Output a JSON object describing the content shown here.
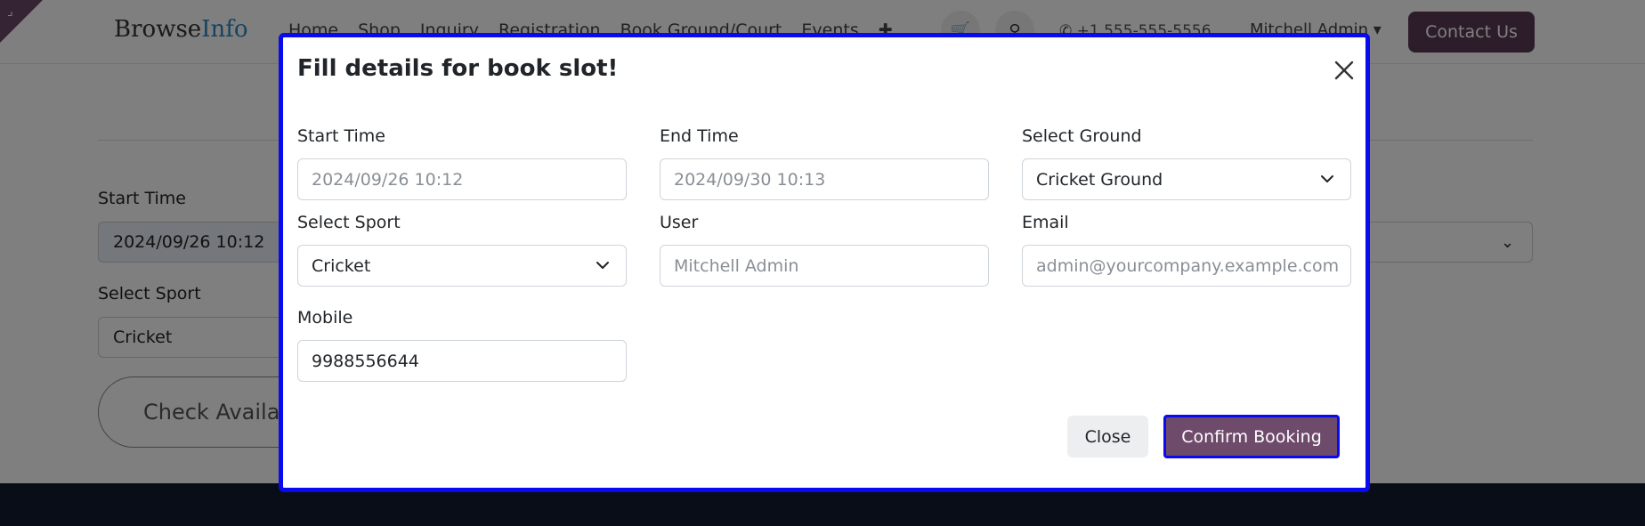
{
  "header": {
    "brand_part1": "Browse",
    "brand_part2": "Info",
    "nav": [
      "Home",
      "Shop",
      "Inquiry",
      "Registration",
      "Book Ground/Court",
      "Events"
    ],
    "phone": "+1 555-555-5556",
    "user": "Mitchell Admin",
    "contact_label": "Contact Us"
  },
  "background_form": {
    "start_time_label": "Start Time",
    "start_time_value": "2024/09/26 10:12",
    "select_sport_label": "Select Sport",
    "select_sport_value": "Cricket",
    "check_button": "Check Availab"
  },
  "modal": {
    "title": "Fill details for book slot!",
    "fields": {
      "start_time": {
        "label": "Start Time",
        "value": "2024/09/26 10:12"
      },
      "end_time": {
        "label": "End Time",
        "value": "2024/09/30 10:13"
      },
      "select_ground": {
        "label": "Select Ground",
        "value": "Cricket Ground"
      },
      "select_sport": {
        "label": "Select Sport",
        "value": "Cricket"
      },
      "user": {
        "label": "User",
        "value": "Mitchell Admin"
      },
      "email": {
        "label": "Email",
        "value": "admin@yourcompany.example.com"
      },
      "mobile": {
        "label": "Mobile",
        "value": "9988556644"
      }
    },
    "close_label": "Close",
    "confirm_label": "Confirm Booking"
  },
  "colors": {
    "primary": "#6e4b6b",
    "focus_outline": "#0a0af0",
    "footer": "#111a2e"
  }
}
